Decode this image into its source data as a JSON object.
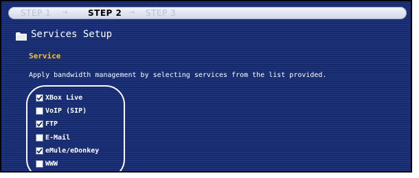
{
  "steps": [
    {
      "label": "STEP 1",
      "active": false
    },
    {
      "label": "STEP 2",
      "active": true
    },
    {
      "label": "STEP 3",
      "active": false
    }
  ],
  "step_separator": "→",
  "page": {
    "title": "Services Setup",
    "title_icon": "folder-icon"
  },
  "section": {
    "heading": "Service",
    "description": "Apply bandwidth management by selecting services from the list provided."
  },
  "services": [
    {
      "label": "XBox Live",
      "checked": true
    },
    {
      "label": "VoIP (SIP)",
      "checked": false
    },
    {
      "label": "FTP",
      "checked": true
    },
    {
      "label": "E-Mail",
      "checked": false
    },
    {
      "label": "eMule/eDonkey",
      "checked": true
    },
    {
      "label": "WWW",
      "checked": false
    }
  ],
  "colors": {
    "background": "#1b2f6e",
    "heading": "#f0c23a",
    "text": "#ffffff",
    "step_active": "#000000",
    "step_inactive": "#b6bfd6"
  }
}
